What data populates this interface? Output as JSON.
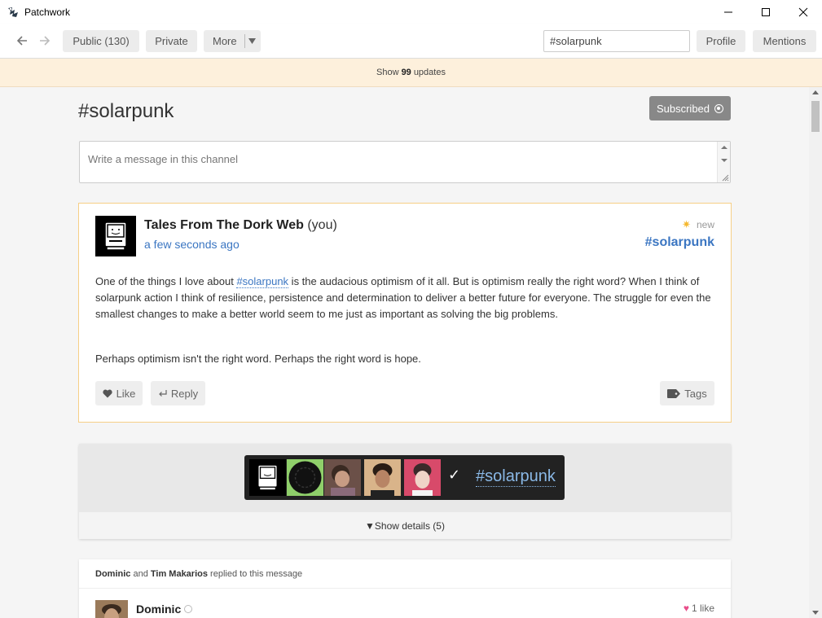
{
  "window": {
    "title": "Patchwork"
  },
  "toolbar": {
    "public_label": "Public (130)",
    "private_label": "Private",
    "more_label": "More",
    "search_value": "#solarpunk",
    "profile_label": "Profile",
    "mentions_label": "Mentions"
  },
  "updates": {
    "prefix": "Show",
    "count": "99",
    "suffix": "updates"
  },
  "channel": {
    "title": "#solarpunk",
    "subscribe_label": "Subscribed",
    "compose_placeholder": "Write a message in this channel"
  },
  "post": {
    "author": "Tales From The Dork Web",
    "author_suffix": "(you)",
    "timestamp": "a few seconds ago",
    "new_label": "new",
    "channel": "#solarpunk",
    "p1_before": "One of the things I love about ",
    "p1_link": "#solarpunk",
    "p1_after": " is the audacious optimism of it all. But is optimism really the right word? When I think of solarpunk action I think of resilience, persistence and determination to deliver a better future for everyone. The struggle for even the smallest changes to make a better world seem to me just as important as solving the big problems.",
    "p2": "Perhaps optimism isn't the right word. Perhaps the right word is hope.",
    "like_label": "Like",
    "reply_label": "Reply",
    "tags_label": "Tags"
  },
  "gathering": {
    "check": "✓",
    "tag": "#solarpunk",
    "details_label": "▼Show details (5)"
  },
  "reply": {
    "name1": "Dominic",
    "and": " and ",
    "name2": "Tim Makarios",
    "suffix": " replied to this message",
    "author": "Dominic",
    "likes": "1 like"
  },
  "colors": {
    "accent": "#3b76c2",
    "banner": "#fdf0dc",
    "new_border": "#f6cf86",
    "subscribed": "#888888",
    "heart": "#e84e8a"
  }
}
